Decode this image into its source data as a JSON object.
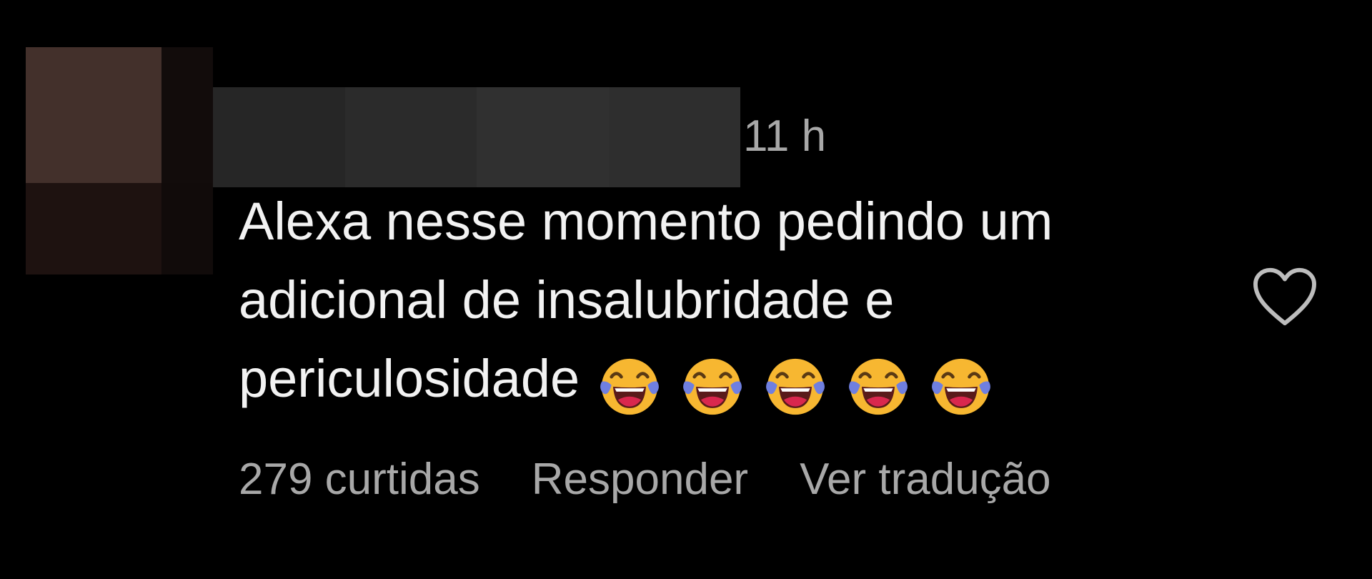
{
  "comment": {
    "timestamp": "11 h",
    "text": "Alexa nesse momento pedindo um adicional de insalubridade e periculosidade",
    "emoji_name": "face-with-tears-of-joy",
    "emoji_count": 5,
    "likes_label": "279 curtidas",
    "reply_label": "Responder",
    "translate_label": "Ver tradução",
    "like_icon": "heart-outline-icon"
  },
  "colors": {
    "background": "#000000",
    "text": "#f2f2f2",
    "secondary_text": "#a8a8a8",
    "emoji_face": "#f7b731",
    "emoji_tears": "#6f7fe0",
    "emoji_mouth": "#d9274e"
  }
}
